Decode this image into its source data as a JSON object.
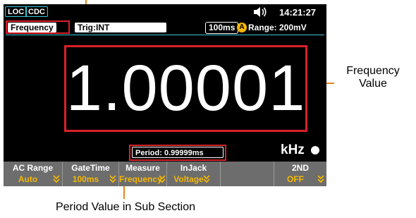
{
  "status": {
    "badges": [
      "LOC",
      "CDC"
    ],
    "time": "14:21:27",
    "speaker_icon": "speaker-icon"
  },
  "function_row": {
    "function_label": "Frequency",
    "trigger": "Trig:INT",
    "gate_rate": "100ms",
    "auto_icon_letter": "A",
    "range": "Range: 200mV"
  },
  "display": {
    "main_value": "1.00001",
    "unit": "kHz",
    "period": "Period:  0.99999ms"
  },
  "softkeys": [
    {
      "name": "AC Range",
      "value": "Auto"
    },
    {
      "name": "GateTime",
      "value": "100ms"
    },
    {
      "name": "Measure",
      "value": "Frequency"
    },
    {
      "name": "InJack",
      "value": "Voltage"
    },
    {
      "name": "",
      "value": ""
    },
    {
      "name": "2ND",
      "value": "OFF"
    }
  ],
  "callouts": {
    "frequency_line1": "Frequency",
    "frequency_line2": "Value",
    "period": "Period Value in Sub Section"
  },
  "colors": {
    "highlight": "#d8202a",
    "callout_line": "#e8861c",
    "softkey_value": "#f5b800"
  }
}
